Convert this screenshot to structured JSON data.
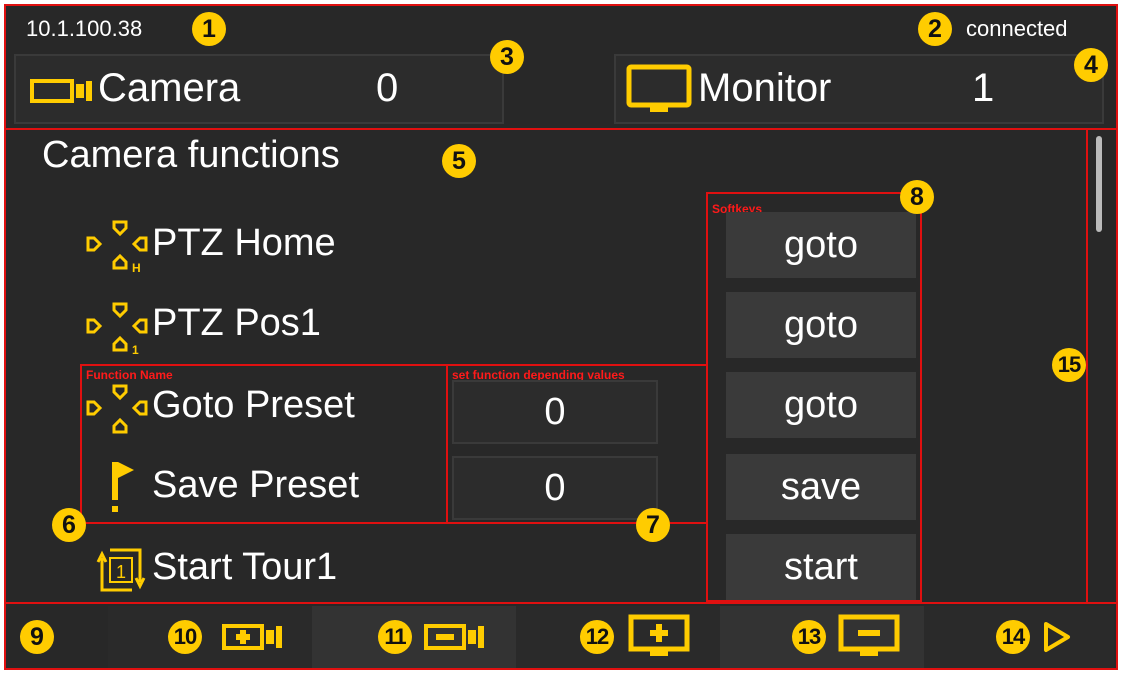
{
  "status_bar": {
    "ip": "10.1.100.38",
    "connection": "connected"
  },
  "camera_panel": {
    "label": "Camera",
    "value": "0",
    "icon": "camera-icon"
  },
  "monitor_panel": {
    "label": "Monitor",
    "value": "1",
    "icon": "monitor-icon"
  },
  "section_title": "Camera functions",
  "annotations": {
    "softkeys": "Softkeys",
    "function_name": "Function Name",
    "set_values": "set function depending values"
  },
  "functions": [
    {
      "name": "PTZ Home",
      "icon": "ptz-home-icon",
      "value": "",
      "softkey": "goto"
    },
    {
      "name": "PTZ Pos1",
      "icon": "ptz-pos1-icon",
      "value": "",
      "softkey": "goto"
    },
    {
      "name": "Goto Preset",
      "icon": "ptz-preset-icon",
      "value": "0",
      "softkey": "goto"
    },
    {
      "name": "Save Preset",
      "icon": "flag-icon",
      "value": "0",
      "softkey": "save"
    },
    {
      "name": "Start Tour1",
      "icon": "tour-icon",
      "value": "",
      "softkey": "start"
    }
  ],
  "toolbar": [
    {
      "icon": "camera-increment-icon"
    },
    {
      "icon": "camera-decrement-icon"
    },
    {
      "icon": "monitor-increment-icon"
    },
    {
      "icon": "monitor-decrement-icon"
    },
    {
      "icon": "next-arrow-icon"
    }
  ],
  "markers": [
    "1",
    "2",
    "3",
    "4",
    "5",
    "6",
    "7",
    "8",
    "9",
    "10",
    "11",
    "12",
    "13",
    "14",
    "15"
  ],
  "colors": {
    "background": "#282828",
    "accent": "#ffcc00",
    "annotation": "#e01010",
    "button": "#3a3a3a",
    "text": "#ffffff"
  }
}
